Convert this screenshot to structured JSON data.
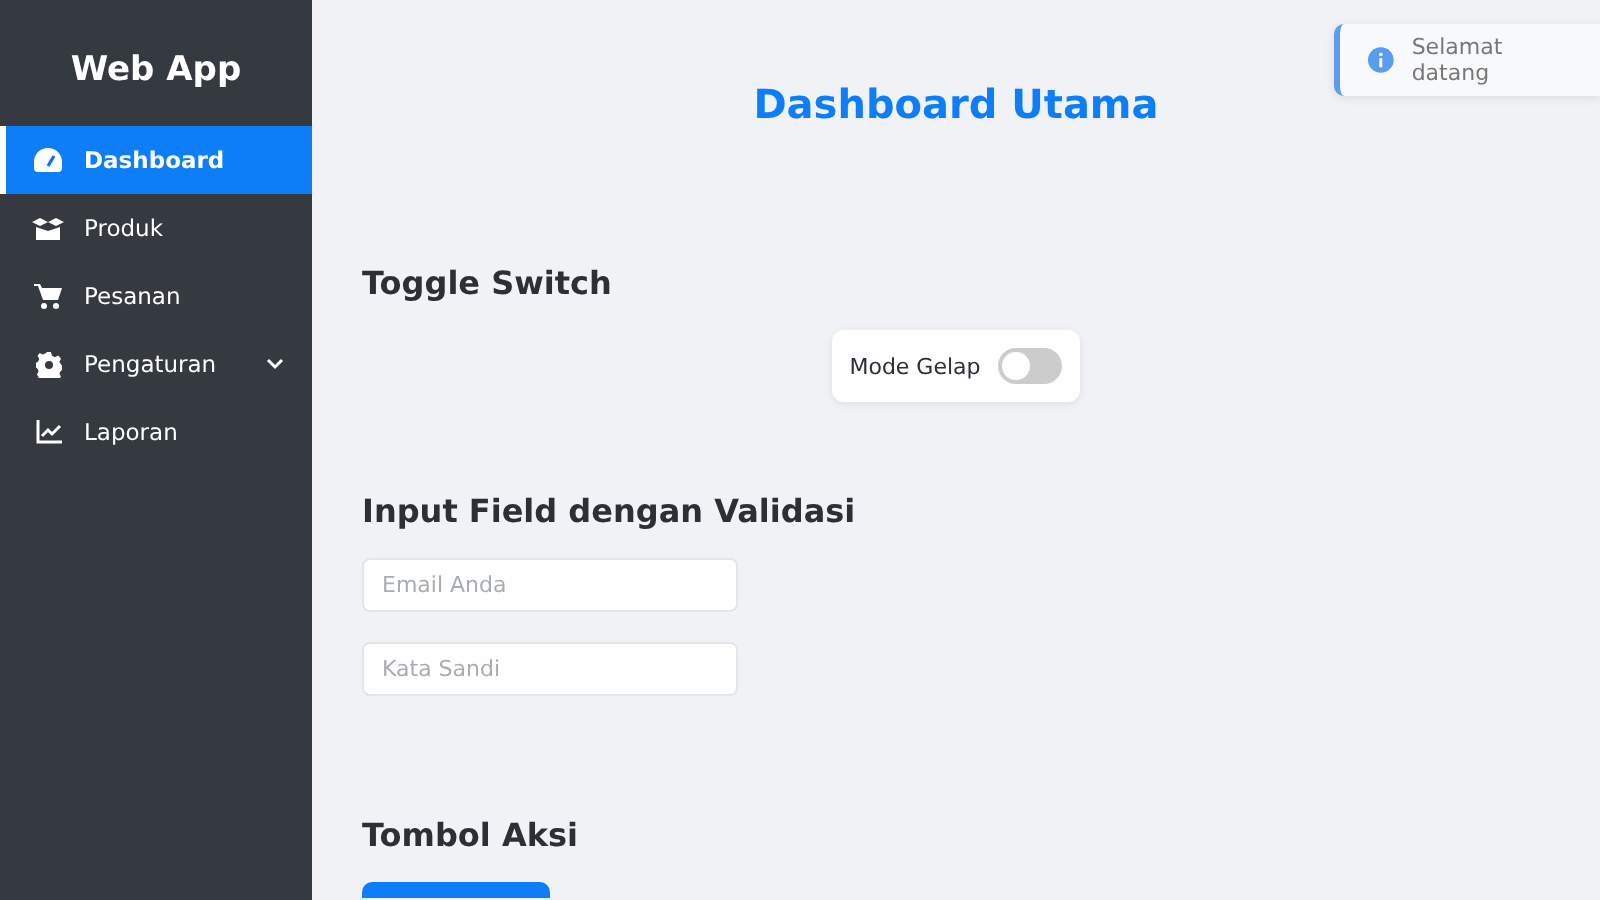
{
  "sidebar": {
    "brand": "Web App",
    "items": [
      {
        "label": "Dashboard",
        "selected": true,
        "kind": "link"
      },
      {
        "label": "Produk",
        "selected": false,
        "kind": "link"
      },
      {
        "label": "Pesanan",
        "selected": false,
        "kind": "link"
      },
      {
        "label": "Pengaturan",
        "selected": false,
        "kind": "submenu"
      },
      {
        "label": "Laporan",
        "selected": false,
        "kind": "link"
      }
    ]
  },
  "toast": {
    "message": "Selamat datang"
  },
  "main": {
    "title": "Dashboard Utama",
    "toggle_section": {
      "heading": "Toggle Switch",
      "label": "Mode Gelap",
      "on": false
    },
    "input_section": {
      "heading": "Input Field dengan Validasi",
      "fields": [
        {
          "placeholder": "Email Anda"
        },
        {
          "placeholder": "Kata Sandi"
        }
      ]
    },
    "button_section": {
      "heading": "Tombol Aksi"
    }
  }
}
